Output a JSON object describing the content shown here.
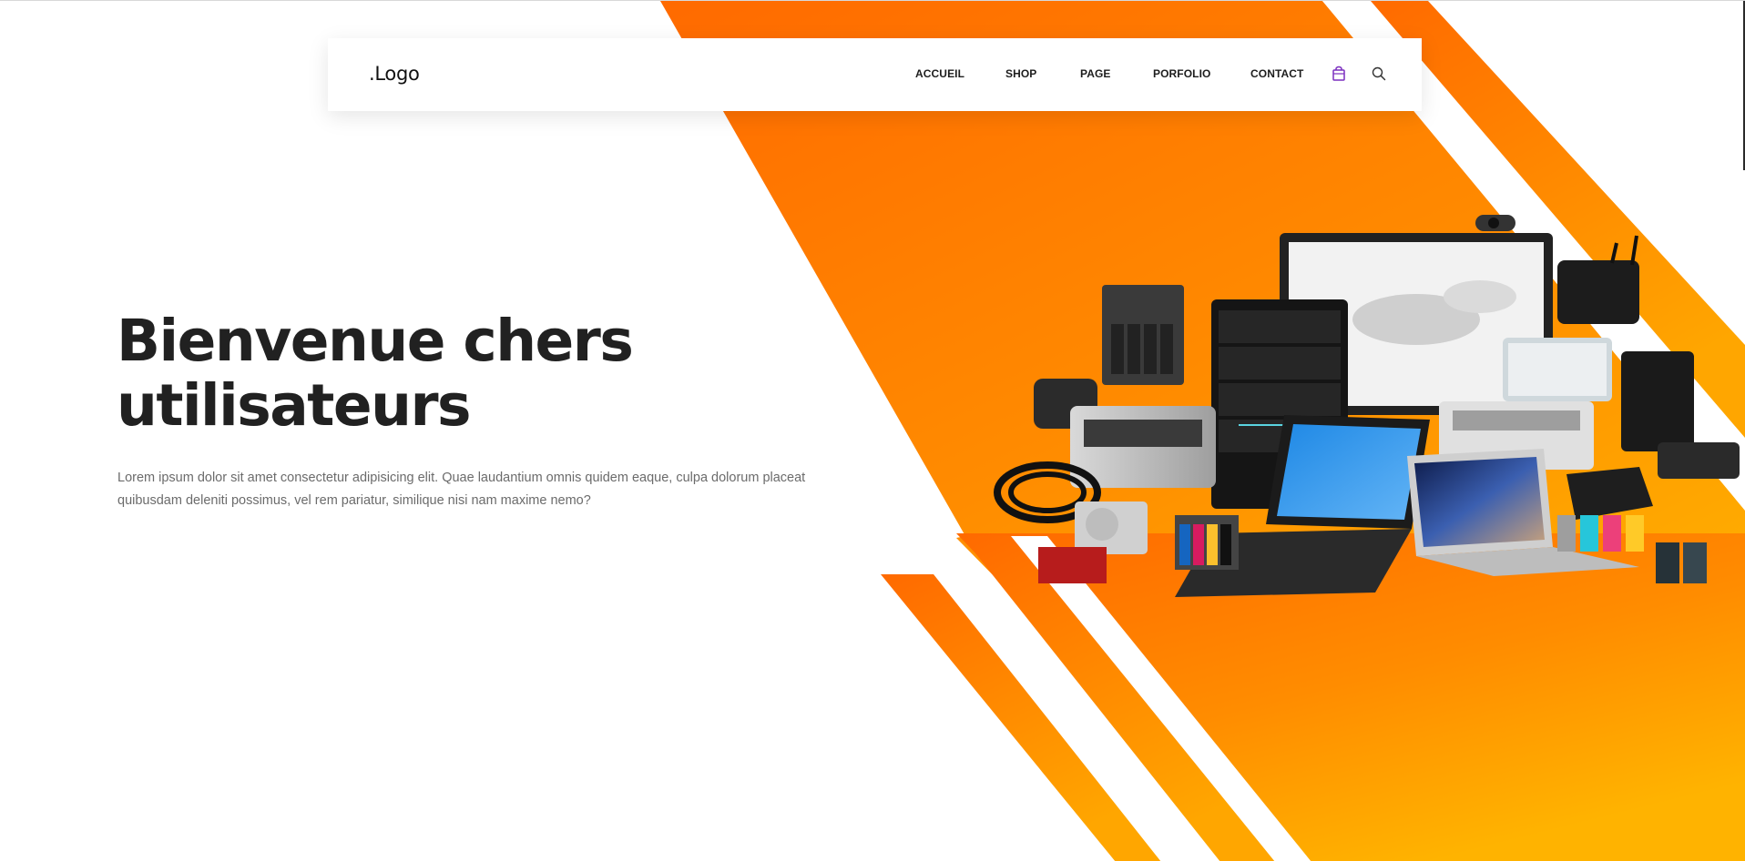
{
  "header": {
    "logo": ".Logo",
    "nav": [
      "ACCUEIL",
      "SHOP",
      "PAGE",
      "PORFOLIO",
      "CONTACT"
    ],
    "cart_icon": "shopping-bag-icon",
    "search_icon": "search-icon"
  },
  "hero": {
    "title_line1": "Bienvenue chers",
    "title_line2": "utilisateurs",
    "text": "Lorem ipsum dolor sit amet consectetur adipisicing elit. Quae laudantium omnis quidem eaque, culpa dolorum placeat quibusdam deleniti possimus, vel rem pariatur, similique nisi nam maxime nemo?"
  },
  "colors": {
    "orange_dark": "#ff6a00",
    "orange_light": "#ffb000",
    "icon_purple": "#7b2fbf",
    "text_dark": "#212121",
    "text_muted": "#6b6b6b"
  }
}
